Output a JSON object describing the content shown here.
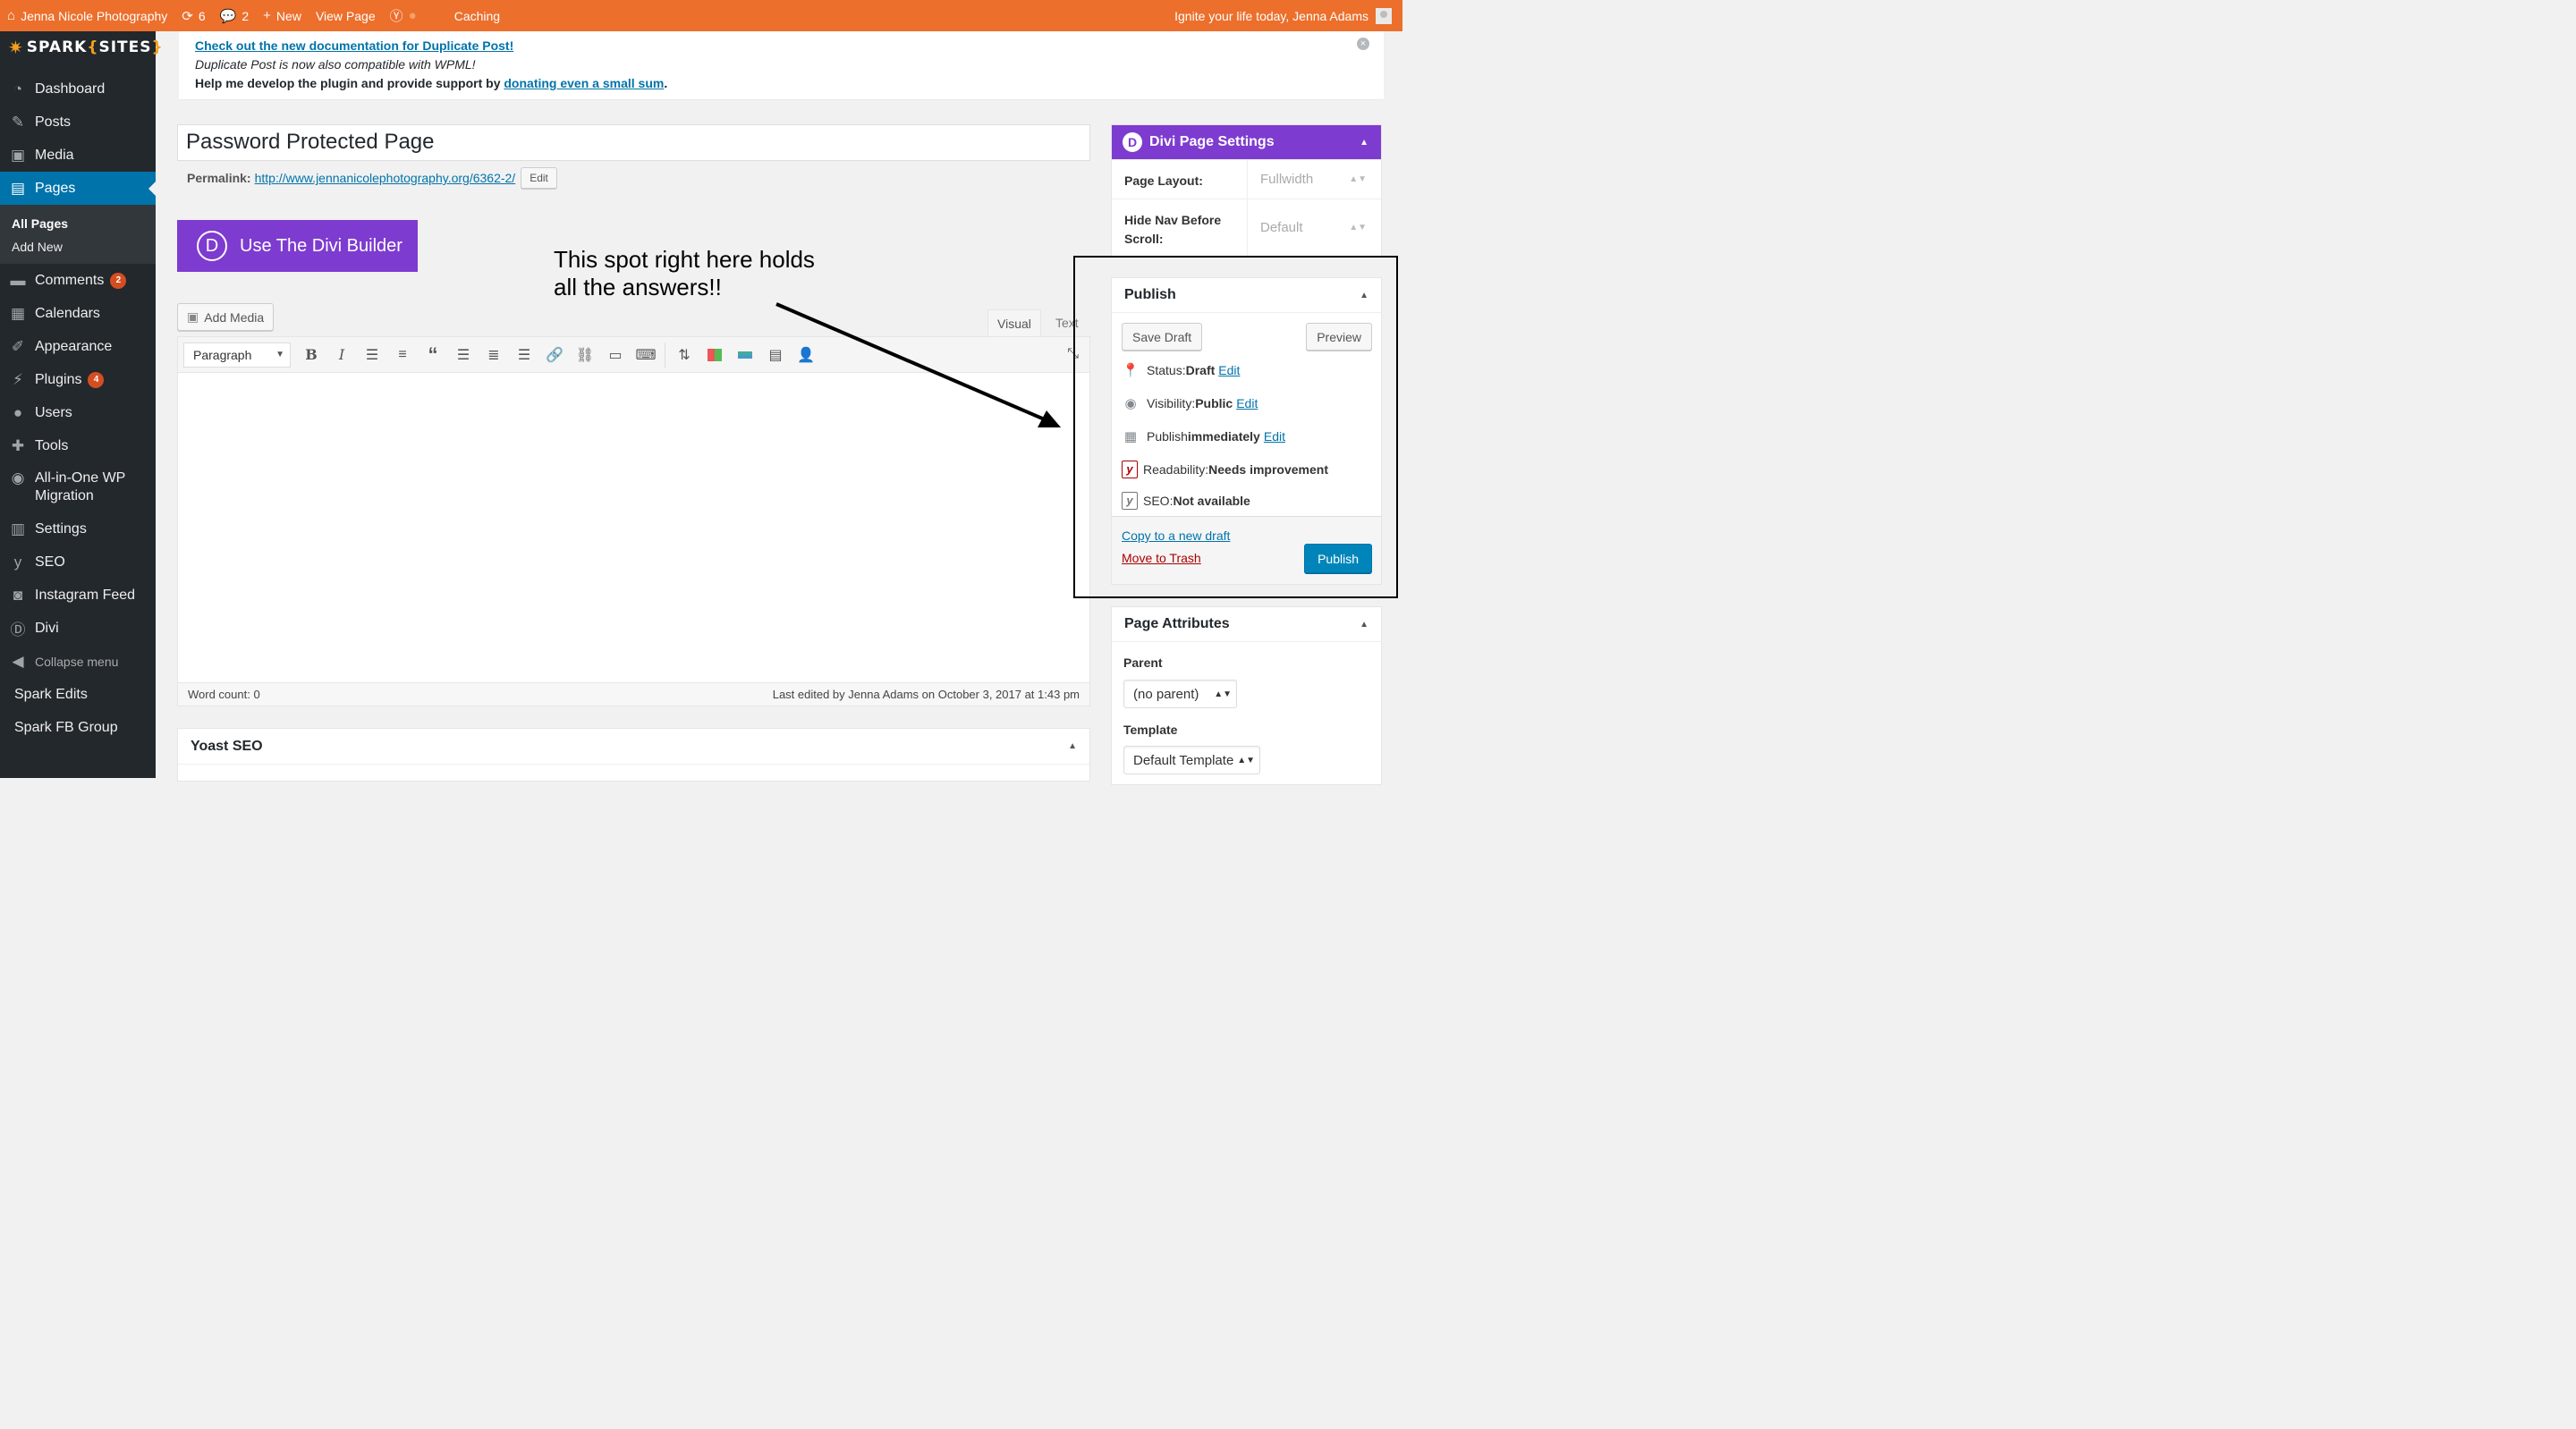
{
  "adminbar": {
    "site_name": "Jenna Nicole Photography",
    "updates_count": "6",
    "comments_count": "2",
    "new_label": "New",
    "view_page_label": "View Page",
    "caching_label": "Caching",
    "greeting": "Ignite your life today, Jenna Adams"
  },
  "logo": {
    "text_pre": "SPARK",
    "text_main": "SITES"
  },
  "sidebar": {
    "items": [
      {
        "label": "Dashboard"
      },
      {
        "label": "Posts"
      },
      {
        "label": "Media"
      },
      {
        "label": "Pages"
      },
      {
        "label": "Comments",
        "badge": "2"
      },
      {
        "label": "Calendars"
      },
      {
        "label": "Appearance"
      },
      {
        "label": "Plugins",
        "badge": "4"
      },
      {
        "label": "Users"
      },
      {
        "label": "Tools"
      },
      {
        "label": "All-in-One WP Migration"
      },
      {
        "label": "Settings"
      },
      {
        "label": "SEO"
      },
      {
        "label": "Instagram Feed"
      },
      {
        "label": "Divi"
      },
      {
        "label": "Collapse menu"
      },
      {
        "label": "Spark Edits"
      },
      {
        "label": "Spark FB Group"
      }
    ],
    "submenu": [
      "All Pages",
      "Add New"
    ]
  },
  "notice": {
    "link1": "Check out the new documentation for Duplicate Post!",
    "line2": "Duplicate Post is now also compatible with WPML!",
    "line3_pre": "Help me develop the plugin and provide support by ",
    "line3_link": "donating even a small sum",
    "line3_post": "."
  },
  "editor": {
    "title": "Password Protected Page",
    "permalink_label": "Permalink:",
    "permalink_url": "http://www.jennanicolephotography.org/6362-2/",
    "permalink_edit": "Edit",
    "divi_button": "Use The Divi Builder",
    "add_media": "Add Media",
    "tab_visual": "Visual",
    "tab_text": "Text",
    "format_select": "Paragraph",
    "word_count": "Word count: 0",
    "last_edited": "Last edited by Jenna Adams on October 3, 2017 at 1:43 pm"
  },
  "yoast": {
    "title": "Yoast SEO"
  },
  "divi_settings": {
    "title": "Divi Page Settings",
    "layout_label": "Page Layout:",
    "layout_value": "Fullwidth",
    "hidenav_label": "Hide Nav Before Scroll:",
    "hidenav_value": "Default"
  },
  "publish": {
    "title": "Publish",
    "save_draft": "Save Draft",
    "preview": "Preview",
    "status_label": "Status: ",
    "status_value": "Draft",
    "visibility_label": "Visibility: ",
    "visibility_value": "Public",
    "publish_label": "Publish ",
    "publish_value": "immediately",
    "edit": "Edit",
    "readability_label": "Readability: ",
    "readability_value": "Needs improvement",
    "seo_label": "SEO: ",
    "seo_value": "Not available",
    "copy_draft": "Copy to a new draft",
    "trash": "Move to Trash",
    "publish_button": "Publish"
  },
  "page_attributes": {
    "title": "Page Attributes",
    "parent_label": "Parent",
    "parent_value": "(no parent)",
    "template_label": "Template",
    "template_value": "Default Template"
  },
  "annotation": {
    "line1": "This spot right here holds",
    "line2": "all the answers!!"
  },
  "colors": {
    "adminbar": "#ec6f2c",
    "sidebar": "#23282d",
    "active": "#0073aa",
    "divi": "#7e3bd0",
    "publish": "#0085ba"
  }
}
